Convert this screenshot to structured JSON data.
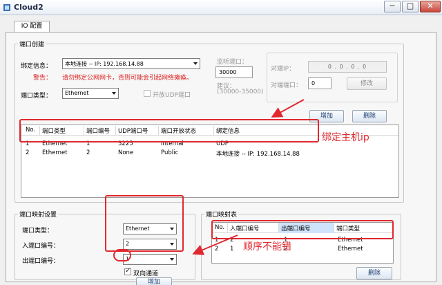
{
  "window": {
    "title": "Cloud2",
    "minimize": "−",
    "maximize": "□",
    "close": "✕"
  },
  "tab": {
    "label": "IO 配置"
  },
  "port_create": {
    "title": "端口创建",
    "bind_label": "绑定信息：",
    "bind_value": "本地连接 -- IP: 192.168.14.88",
    "warning_label": "警告：",
    "warning_text": "请勿绑定公网网卡，否则可能会引起网络瘫痪。",
    "port_type_label": "端口类型：",
    "port_type_value": "Ethernet",
    "open_udp_label": "开放UDP端口",
    "listen_port_label": "监听端口：",
    "listen_port_value": "30000",
    "suggest_label": "建议：",
    "suggest_range": "(30000-35000)",
    "peer_ip_label": "对端IP：",
    "peer_ip_value": "0 . 0 . 0 . 0",
    "peer_port_label": "对端端口：",
    "peer_port_value": "0",
    "modify_button": "修改",
    "add_button": "增加",
    "delete_button": "删除"
  },
  "port_table": {
    "columns": [
      "No.",
      "端口类型",
      "端口编号",
      "UDP端口号",
      "端口开放状态",
      "绑定信息"
    ],
    "rows": [
      [
        "1",
        "Ethernet",
        "1",
        "3225",
        "Internal",
        "UDP"
      ],
      [
        "2",
        "Ethernet",
        "2",
        "None",
        "Public",
        "本地连接 -- IP: 192.168.14.88"
      ]
    ]
  },
  "mapping_settings": {
    "title": "端口映射设置",
    "port_type_label": "端口类型：",
    "port_type_value": "Ethernet",
    "in_port_label": "入端口编号：",
    "in_port_value": "2",
    "out_port_label": "出端口编号：",
    "out_port_value": "1",
    "bidirectional_label": "双向通道",
    "add_button": "增加"
  },
  "mapping_table": {
    "title": "端口映射表",
    "columns": [
      "No.",
      "入端口编号",
      "出端口编号",
      "端口类型"
    ],
    "rows": [
      [
        "1",
        "2",
        "1",
        "Ethernet"
      ],
      [
        "2",
        "1",
        "2",
        "Ethernet"
      ]
    ],
    "delete_button": "删除"
  },
  "annotations": {
    "bind_host_ip": "绑定主机ip",
    "order_correct": "顺序不能错",
    "color": "#e0282e"
  }
}
